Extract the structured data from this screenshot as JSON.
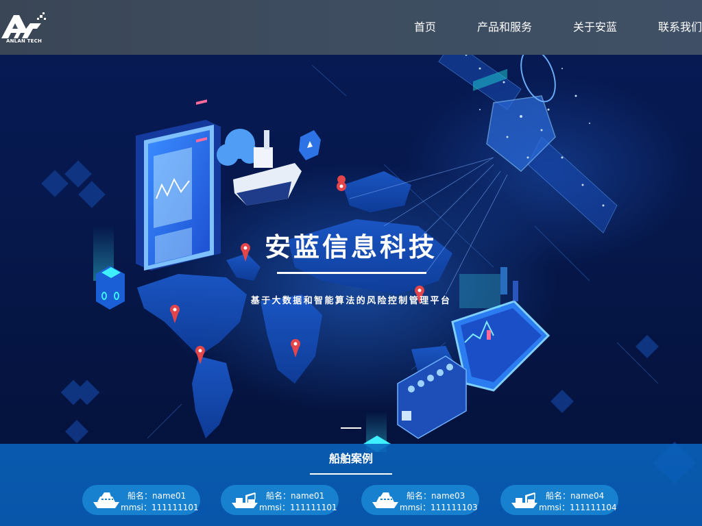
{
  "brand": {
    "logo_caption": "ANLAN TECH"
  },
  "nav": {
    "items": [
      {
        "label": "首页"
      },
      {
        "label": "产品和服务"
      },
      {
        "label": "关于安蓝"
      },
      {
        "label": "联系我们"
      }
    ]
  },
  "hero": {
    "title": "安蓝信息科技",
    "subtitle": "基于大数据和智能算法的风险控制管理平台"
  },
  "cases": {
    "title": "船舶案例",
    "items": [
      {
        "icon": "cruise-ship-icon",
        "name": "船名：name01",
        "mmsi": "mmsi：111111101"
      },
      {
        "icon": "crane-ship-icon",
        "name": "船名：name01",
        "mmsi": "mmsi：111111101"
      },
      {
        "icon": "cruise-ship-icon",
        "name": "船名：name03",
        "mmsi": "mmsi：111111103"
      },
      {
        "icon": "crane-ship-icon",
        "name": "船名：name04",
        "mmsi": "mmsi：111111104"
      }
    ]
  },
  "colors": {
    "nav_bg": "#3e4d60",
    "hero_bg": "#06184c",
    "cases_bg": "#0a64be",
    "card_bg": "#1780cf",
    "pin": "#e2454a"
  }
}
